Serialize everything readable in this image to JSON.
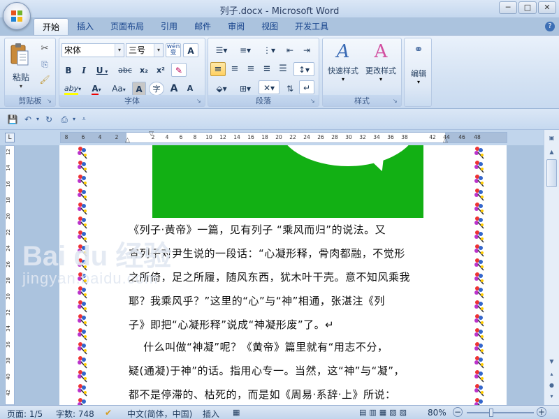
{
  "window": {
    "title": "列子.docx - Microsoft Word",
    "min": "─",
    "max": "□",
    "close": "✕"
  },
  "tabs": [
    "开始",
    "插入",
    "页面布局",
    "引用",
    "邮件",
    "审阅",
    "视图",
    "开发工具"
  ],
  "active_tab": "开始",
  "help": "?",
  "ribbon": {
    "clipboard": {
      "label": "剪贴板",
      "paste": "粘贴"
    },
    "font": {
      "label": "字体",
      "name": "宋体",
      "size": "三号",
      "wen": "wén\n变",
      "A_box": "A",
      "bold": "B",
      "italic": "I",
      "underline": "U",
      "strike": "abc",
      "sub": "x₂",
      "sup": "x²",
      "highlight": "aby",
      "fontcolor": "A",
      "aa": "Aa",
      "char_shade": "A",
      "enclose": "字",
      "grow": "A",
      "shrink": "A"
    },
    "paragraph": {
      "label": "段落"
    },
    "styles": {
      "label": "样式",
      "quick": "快速样式",
      "change": "更改样式"
    },
    "editing": {
      "label": "编辑",
      "btn": "编辑"
    }
  },
  "document": {
    "lines": [
      "《列子·黄帝》一篇，见有列子 “乘风而归”的说法。又",
      "有列子对尹生说的一段话：“心凝形释，骨肉都融，不觉形",
      "之所倚，足之所履，随风东西，犹木叶干壳。意不知风乘我",
      "耶？我乘风乎？”这里的“心”与“神”相通，张湛注《列",
      "子》即把“心凝形释”说成“神凝形废”了。↵",
      "    什么叫做“神凝”呢？《黄帝》篇里就有“用志不分，",
      "疑(通凝)于神”的话。指用心专一。当然，这“神”与“凝”，",
      "都不是停滞的、枯死的，而是如《周易·系辞·上》所说："
    ]
  },
  "ruler": {
    "ticks": [
      "8",
      "6",
      "4",
      "2",
      "2",
      "4",
      "6",
      "8",
      "10",
      "12",
      "14",
      "16",
      "18",
      "20",
      "22",
      "24",
      "26",
      "28",
      "30",
      "32",
      "34",
      "36",
      "38",
      "42",
      "44",
      "46",
      "48"
    ],
    "vticks": [
      "12",
      "14",
      "16",
      "18",
      "20",
      "22",
      "24",
      "26",
      "28",
      "30",
      "32",
      "34",
      "36",
      "38",
      "40",
      "42"
    ]
  },
  "status": {
    "page": "页面: 1/5",
    "words": "字数: 748",
    "lang": "中文(简体，中国)",
    "mode": "插入",
    "zoom": "80%"
  },
  "watermark": {
    "brand": "Bai du 经验",
    "site": "jingyan.baidu.com"
  },
  "colors": {
    "green": "#12b014",
    "ribbon": "#d4e2f3"
  }
}
